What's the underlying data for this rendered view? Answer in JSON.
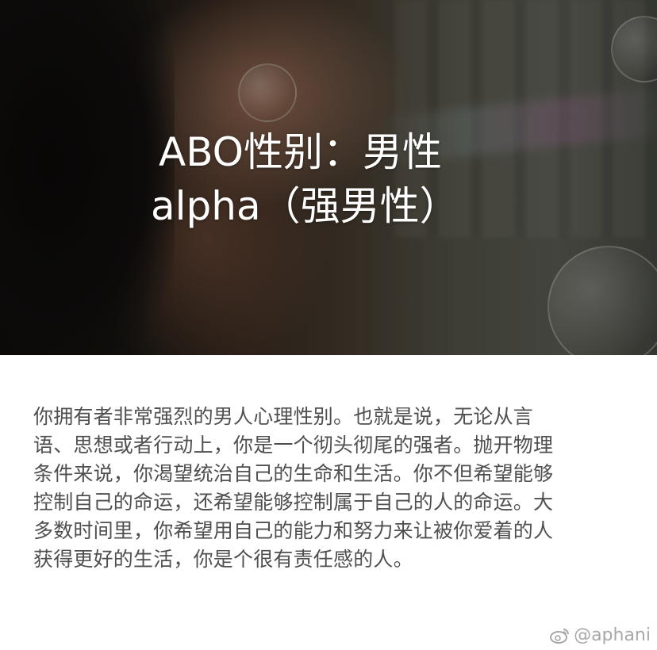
{
  "header": {
    "title_line1": "ABO性别：男性",
    "title_line2": "alpha（强男性）"
  },
  "body": {
    "lines": [
      "你拥有者非常强烈的男人心理性别。也就是说，无论从言",
      "语、思想或者行动上，你是一个彻头彻尾的强者。抛开物理",
      "条件来说，你渴望统治自己的生命和生活。你不但希望能够",
      "控制自己的命运，还希望能够控制属于自己的人的命运。大",
      "多数时间里，你希望用自己的能力和努力来让被你爱着的人",
      "获得更好的生活，你是个很有责任感的人。"
    ]
  },
  "watermark": {
    "icon": "weibo-logo-icon",
    "handle": "@aphani"
  },
  "colors": {
    "background": "#ffffff",
    "title_text": "#ffffff",
    "body_text": "#4f4f4f",
    "watermark": "#a8a8a8"
  }
}
